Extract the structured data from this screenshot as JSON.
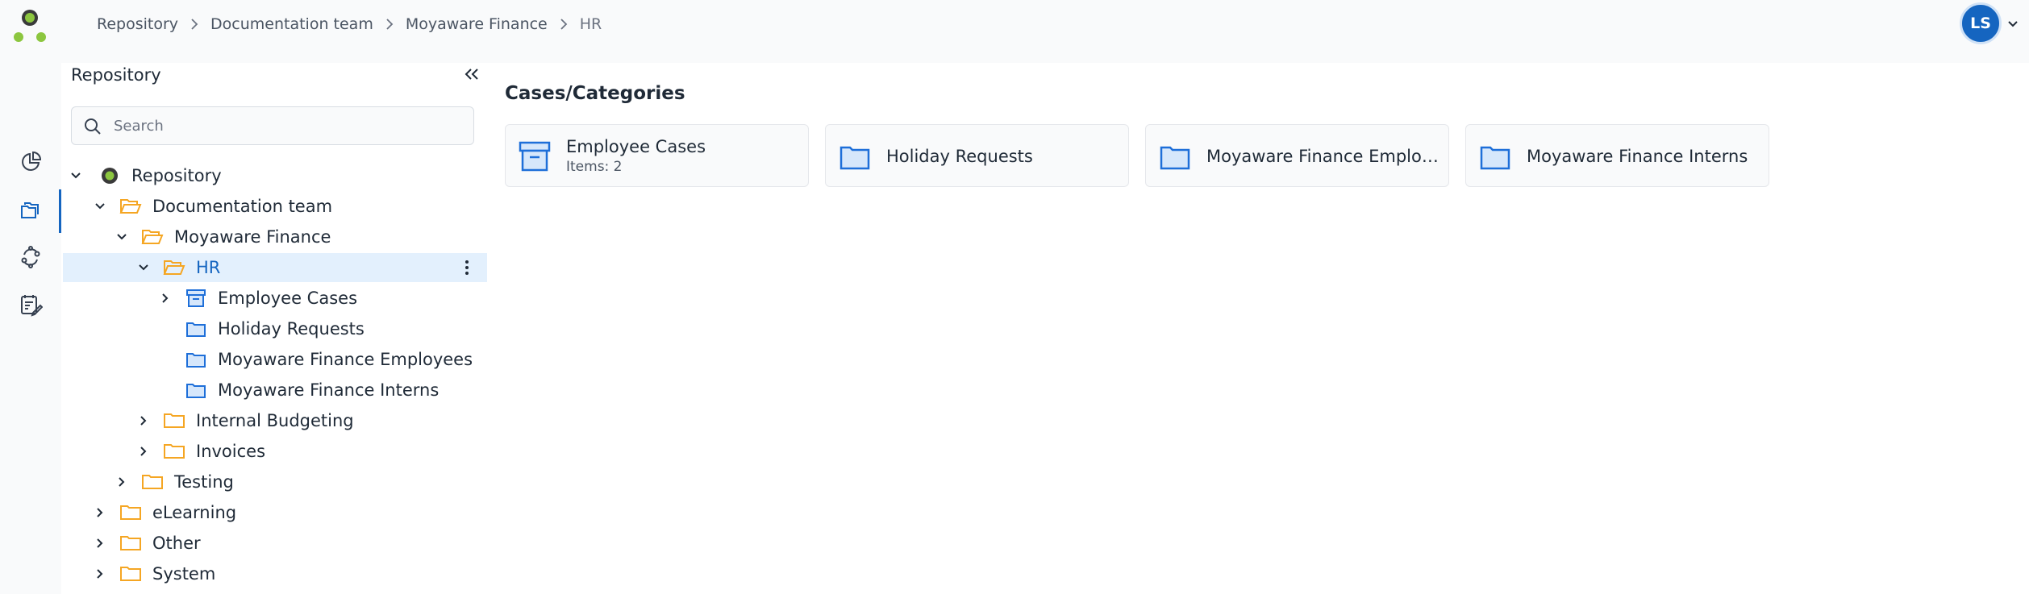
{
  "breadcrumb": {
    "items": [
      "Repository",
      "Documentation team",
      "Moyaware Finance",
      "HR"
    ]
  },
  "user": {
    "initials": "LS"
  },
  "rail": {
    "items": [
      "dashboard-icon",
      "repository-icon",
      "workflow-icon",
      "tasks-icon"
    ],
    "active": "repository-icon"
  },
  "panel": {
    "title": "Repository",
    "search_placeholder": "Search"
  },
  "tree": {
    "items": [
      {
        "label": "Repository",
        "icon": "repository-root-icon",
        "expanded": true,
        "depth": 0
      },
      {
        "label": "Documentation team",
        "icon": "folder-open-icon",
        "expanded": true,
        "depth": 1
      },
      {
        "label": "Moyaware Finance",
        "icon": "folder-open-icon",
        "expanded": true,
        "depth": 2
      },
      {
        "label": "HR",
        "icon": "folder-open-icon",
        "expanded": true,
        "selected": true,
        "depth": 3
      },
      {
        "label": "Employee Cases",
        "icon": "case-box-icon",
        "expanded": false,
        "depth": 4
      },
      {
        "label": "Holiday Requests",
        "icon": "category-folder-icon",
        "depth": 4
      },
      {
        "label": "Moyaware Finance Employees",
        "icon": "category-folder-icon",
        "depth": 4
      },
      {
        "label": "Moyaware Finance Interns",
        "icon": "category-folder-icon",
        "depth": 4
      },
      {
        "label": "Internal Budgeting",
        "icon": "folder-icon",
        "expanded": false,
        "depth": 3
      },
      {
        "label": "Invoices",
        "icon": "folder-icon",
        "expanded": false,
        "depth": 3
      },
      {
        "label": "Testing",
        "icon": "folder-icon",
        "expanded": false,
        "depth": 2
      },
      {
        "label": "eLearning",
        "icon": "folder-icon",
        "expanded": false,
        "depth": 1
      },
      {
        "label": "Other",
        "icon": "folder-icon",
        "expanded": false,
        "depth": 1
      },
      {
        "label": "System",
        "icon": "folder-icon",
        "expanded": false,
        "depth": 1
      }
    ]
  },
  "main": {
    "title": "Cases/Categories",
    "cards": [
      {
        "name": "Employee Cases",
        "sub": "Items: 2",
        "icon": "case-box-icon"
      },
      {
        "name": "Holiday Requests",
        "icon": "category-folder-icon"
      },
      {
        "name": "Moyaware Finance Employees",
        "icon": "category-folder-icon"
      },
      {
        "name": "Moyaware Finance Interns",
        "icon": "category-folder-icon"
      }
    ]
  },
  "colors": {
    "accent": "#1565c0",
    "selected_bg": "#e3f0fd",
    "folder_yellow": "#f5a623",
    "category_blue": "#1e6fd9",
    "logo_green": "#8cc63f"
  }
}
